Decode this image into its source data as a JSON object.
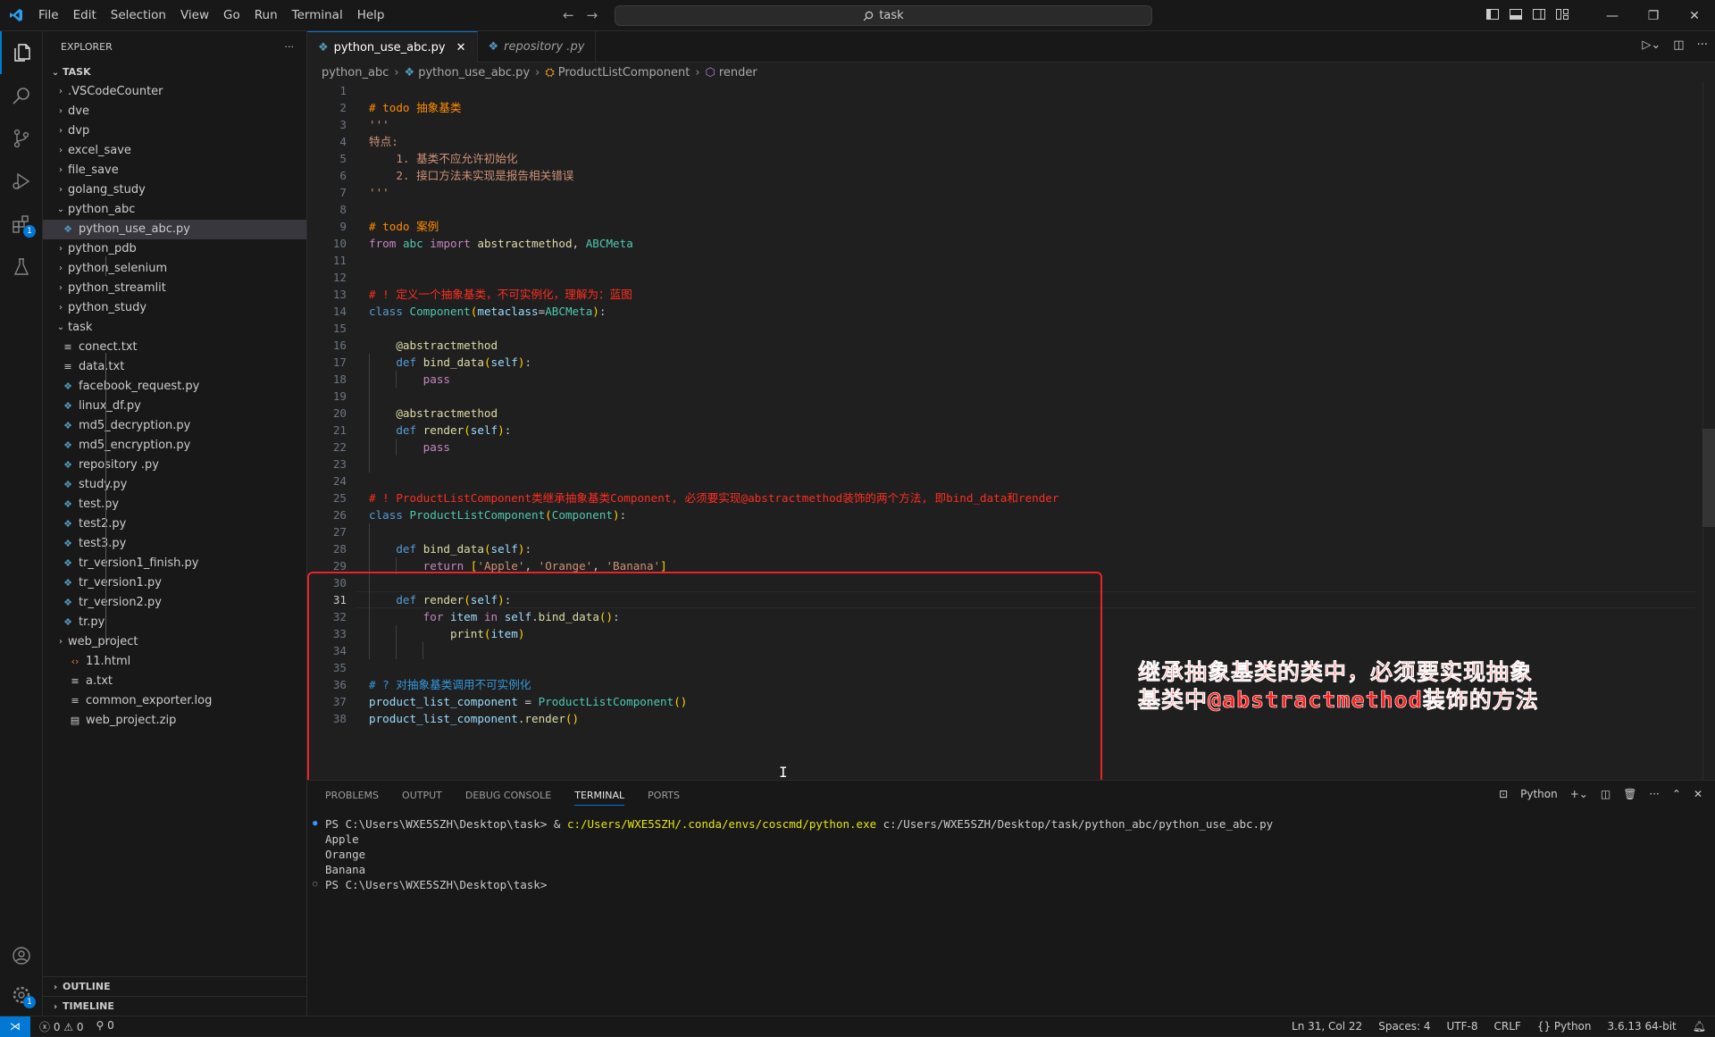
{
  "menu": [
    "File",
    "Edit",
    "Selection",
    "View",
    "Go",
    "Run",
    "Terminal",
    "Help"
  ],
  "command_center": "task",
  "explorer": {
    "title": "EXPLORER",
    "root": "TASK",
    "items": [
      {
        "label": ".VSCodeCounter",
        "type": "folder",
        "depth": 0,
        "open": false
      },
      {
        "label": "dve",
        "type": "folder",
        "depth": 0,
        "open": false
      },
      {
        "label": "dvp",
        "type": "folder",
        "depth": 0,
        "open": false
      },
      {
        "label": "excel_save",
        "type": "folder",
        "depth": 0,
        "open": false
      },
      {
        "label": "file_save",
        "type": "folder",
        "depth": 0,
        "open": false
      },
      {
        "label": "golang_study",
        "type": "folder",
        "depth": 0,
        "open": false
      },
      {
        "label": "python_abc",
        "type": "folder",
        "depth": 0,
        "open": true
      },
      {
        "label": "python_use_abc.py",
        "type": "py",
        "depth": 1,
        "selected": true
      },
      {
        "label": "python_pdb",
        "type": "folder",
        "depth": 0,
        "open": false
      },
      {
        "label": "python_selenium",
        "type": "folder",
        "depth": 0,
        "open": false
      },
      {
        "label": "python_streamlit",
        "type": "folder",
        "depth": 0,
        "open": false
      },
      {
        "label": "python_study",
        "type": "folder",
        "depth": 0,
        "open": false
      },
      {
        "label": "task",
        "type": "folder",
        "depth": 0,
        "open": true
      },
      {
        "label": "conect.txt",
        "type": "txt",
        "depth": 1
      },
      {
        "label": "data.txt",
        "type": "txt",
        "depth": 1
      },
      {
        "label": "facebook_request.py",
        "type": "py",
        "depth": 1
      },
      {
        "label": "linux_df.py",
        "type": "py",
        "depth": 1
      },
      {
        "label": "md5_decryption.py",
        "type": "py",
        "depth": 1
      },
      {
        "label": "md5_encryption.py",
        "type": "py",
        "depth": 1
      },
      {
        "label": "repository .py",
        "type": "py",
        "depth": 1
      },
      {
        "label": "study.py",
        "type": "py",
        "depth": 1
      },
      {
        "label": "test.py",
        "type": "py",
        "depth": 1
      },
      {
        "label": "test2.py",
        "type": "py",
        "depth": 1
      },
      {
        "label": "test3.py",
        "type": "py",
        "depth": 1
      },
      {
        "label": "tr_version1_finish.py",
        "type": "py",
        "depth": 1
      },
      {
        "label": "tr_version1.py",
        "type": "py",
        "depth": 1
      },
      {
        "label": "tr_version2.py",
        "type": "py",
        "depth": 1
      },
      {
        "label": "tr.py",
        "type": "py",
        "depth": 1
      },
      {
        "label": "web_project",
        "type": "folder",
        "depth": 0,
        "open": false
      },
      {
        "label": "11.html",
        "type": "html",
        "depth": 0
      },
      {
        "label": "a.txt",
        "type": "txt",
        "depth": 0
      },
      {
        "label": "common_exporter.log",
        "type": "txt",
        "depth": 0
      },
      {
        "label": "web_project.zip",
        "type": "zip",
        "depth": 0
      }
    ],
    "outline": "OUTLINE",
    "timeline": "TIMELINE"
  },
  "tabs": [
    {
      "label": "python_use_abc.py",
      "active": true
    },
    {
      "label": "repository .py",
      "active": false
    }
  ],
  "breadcrumb": [
    "python_abc",
    "python_use_abc.py",
    "ProductListComponent",
    "render"
  ],
  "code": {
    "current_line": 31,
    "lines": [
      [],
      [
        [
          "c-comment-todo",
          "# todo 抽象基类"
        ]
      ],
      [
        [
          "c-str",
          "'''"
        ]
      ],
      [
        [
          "c-str",
          "特点:"
        ]
      ],
      [
        [
          "c-str",
          "    1. 基类不应允许初始化"
        ]
      ],
      [
        [
          "c-str",
          "    2. 接口方法未实现是报告相关错误"
        ]
      ],
      [
        [
          "c-str",
          "'''"
        ]
      ],
      [],
      [
        [
          "c-comment-todo",
          "# todo 案例"
        ]
      ],
      [
        [
          "c-ctrl",
          "from"
        ],
        [
          "c-def",
          " "
        ],
        [
          "c-cls",
          "abc"
        ],
        [
          "c-def",
          " "
        ],
        [
          "c-ctrl",
          "import"
        ],
        [
          "c-def",
          " "
        ],
        [
          "c-fn",
          "abstractmethod"
        ],
        [
          "c-def",
          ", "
        ],
        [
          "c-cls",
          "ABCMeta"
        ]
      ],
      [],
      [],
      [
        [
          "c-comment-alert",
          "# ! 定义一个抽象基类，不可实例化，理解为：蓝图"
        ]
      ],
      [
        [
          "c-kw",
          "class"
        ],
        [
          "c-def",
          " "
        ],
        [
          "c-cls",
          "Component"
        ],
        [
          "c-punc",
          "("
        ],
        [
          "c-var",
          "metaclass"
        ],
        [
          "c-def",
          "="
        ],
        [
          "c-cls",
          "ABCMeta"
        ],
        [
          "c-punc",
          ")"
        ],
        [
          "c-def",
          ":"
        ]
      ],
      [],
      [
        [
          "c-def",
          "    "
        ],
        [
          "c-deco",
          "@abstractmethod"
        ]
      ],
      [
        [
          "c-def",
          "    "
        ],
        [
          "c-kw",
          "def"
        ],
        [
          "c-def",
          " "
        ],
        [
          "c-fn",
          "bind_data"
        ],
        [
          "c-punc",
          "("
        ],
        [
          "c-var",
          "self"
        ],
        [
          "c-punc",
          ")"
        ],
        [
          "c-def",
          ":"
        ]
      ],
      [
        [
          "c-def",
          "        "
        ],
        [
          "c-ctrl",
          "pass"
        ]
      ],
      [],
      [
        [
          "c-def",
          "    "
        ],
        [
          "c-deco",
          "@abstractmethod"
        ]
      ],
      [
        [
          "c-def",
          "    "
        ],
        [
          "c-kw",
          "def"
        ],
        [
          "c-def",
          " "
        ],
        [
          "c-fn",
          "render"
        ],
        [
          "c-punc",
          "("
        ],
        [
          "c-var",
          "self"
        ],
        [
          "c-punc",
          ")"
        ],
        [
          "c-def",
          ":"
        ]
      ],
      [
        [
          "c-def",
          "        "
        ],
        [
          "c-ctrl",
          "pass"
        ]
      ],
      [],
      [],
      [
        [
          "c-comment-alert",
          "# ! ProductListComponent类继承抽象基类Component, 必须要实现@abstractmethod装饰的两个方法, 即bind_data和render"
        ]
      ],
      [
        [
          "c-kw",
          "class"
        ],
        [
          "c-def",
          " "
        ],
        [
          "c-cls",
          "ProductListComponent"
        ],
        [
          "c-punc",
          "("
        ],
        [
          "c-cls",
          "Component"
        ],
        [
          "c-punc",
          ")"
        ],
        [
          "c-def",
          ":"
        ]
      ],
      [],
      [
        [
          "c-def",
          "    "
        ],
        [
          "c-kw",
          "def"
        ],
        [
          "c-def",
          " "
        ],
        [
          "c-fn",
          "bind_data"
        ],
        [
          "c-punc",
          "("
        ],
        [
          "c-var",
          "self"
        ],
        [
          "c-punc",
          ")"
        ],
        [
          "c-def",
          ":"
        ]
      ],
      [
        [
          "c-def",
          "        "
        ],
        [
          "c-ctrl",
          "return"
        ],
        [
          "c-def",
          " "
        ],
        [
          "c-punc",
          "["
        ],
        [
          "c-str",
          "'Apple'"
        ],
        [
          "c-def",
          ", "
        ],
        [
          "c-str",
          "'Orange'"
        ],
        [
          "c-def",
          ", "
        ],
        [
          "c-str",
          "'Banana'"
        ],
        [
          "c-punc",
          "]"
        ]
      ],
      [],
      [
        [
          "c-def",
          "    "
        ],
        [
          "c-kw",
          "def"
        ],
        [
          "c-def",
          " "
        ],
        [
          "c-fn",
          "render"
        ],
        [
          "c-punc",
          "("
        ],
        [
          "c-var",
          "self"
        ],
        [
          "c-punc",
          ")"
        ],
        [
          "c-def",
          ":"
        ]
      ],
      [
        [
          "c-def",
          "        "
        ],
        [
          "c-ctrl",
          "for"
        ],
        [
          "c-def",
          " "
        ],
        [
          "c-var",
          "item"
        ],
        [
          "c-def",
          " "
        ],
        [
          "c-ctrl",
          "in"
        ],
        [
          "c-def",
          " "
        ],
        [
          "c-var",
          "self"
        ],
        [
          "c-def",
          "."
        ],
        [
          "c-fn",
          "bind_data"
        ],
        [
          "c-punc",
          "()"
        ],
        [
          "c-def",
          ":"
        ]
      ],
      [
        [
          "c-def",
          "            "
        ],
        [
          "c-fn",
          "print"
        ],
        [
          "c-punc",
          "("
        ],
        [
          "c-var",
          "item"
        ],
        [
          "c-punc",
          ")"
        ]
      ],
      [],
      [],
      [
        [
          "c-comment-q",
          "# ? 对抽象基类调用不可实例化"
        ]
      ],
      [
        [
          "c-var",
          "product_list_component"
        ],
        [
          "c-def",
          " = "
        ],
        [
          "c-cls",
          "ProductListComponent"
        ],
        [
          "c-punc",
          "()"
        ]
      ],
      [
        [
          "c-var",
          "product_list_component"
        ],
        [
          "c-def",
          "."
        ],
        [
          "c-fn",
          "render"
        ],
        [
          "c-punc",
          "()"
        ]
      ]
    ]
  },
  "annotation": [
    "继承抽象基类的类中，必须要实现抽象",
    "基类中@abstractmethod装饰的方法"
  ],
  "panel": {
    "tabs": [
      "PROBLEMS",
      "OUTPUT",
      "DEBUG CONSOLE",
      "TERMINAL",
      "PORTS"
    ],
    "active_tab": "TERMINAL",
    "shell": "Python",
    "terminal": {
      "prompt1": "PS C:\\Users\\WXE5SZH\\Desktop\\task> ",
      "cmd_amp": "& ",
      "cmd_exe": "c:/Users/WXE5SZH/.conda/envs/coscmd/python.exe",
      "cmd_arg": " c:/Users/WXE5SZH/Desktop/task/python_abc/python_use_abc.py",
      "out": [
        "Apple",
        "Orange",
        "Banana"
      ],
      "prompt2": "PS C:\\Users\\WXE5SZH\\Desktop\\task>"
    }
  },
  "status": {
    "errors": "0",
    "warnings": "0",
    "ports": "0",
    "position": "Ln 31, Col 22",
    "spaces": "Spaces: 4",
    "encoding": "UTF-8",
    "eol": "CRLF",
    "language": "Python",
    "interpreter": "3.6.13 64-bit"
  },
  "colors": {
    "accent": "#0078d4",
    "annotation": "#ff1f1f",
    "box": "#e8232b"
  }
}
